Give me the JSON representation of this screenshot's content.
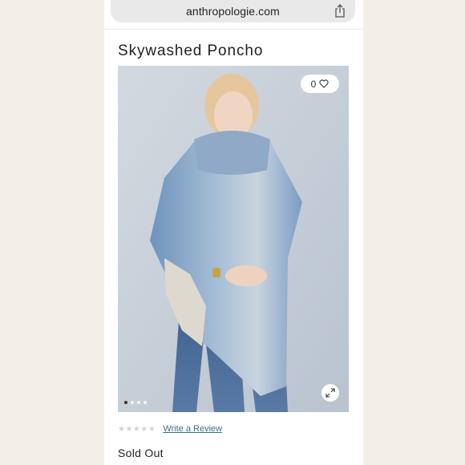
{
  "browser": {
    "url": "anthropologie.com",
    "share_icon": "share-icon"
  },
  "product": {
    "title": "Skywashed Poncho",
    "likes": "0",
    "heart_icon": "heart-icon",
    "expand_icon": "expand-icon",
    "gallery": {
      "image_count": 4,
      "active_index": 0
    },
    "rating": {
      "stars": "★★★★★",
      "value": 0,
      "max": 5
    },
    "write_review_label": "Write a Review",
    "availability": "Sold Out"
  },
  "colors": {
    "link": "#3a6f8f",
    "background": "#f6f3ec",
    "stars_empty": "#d4d4d4"
  }
}
